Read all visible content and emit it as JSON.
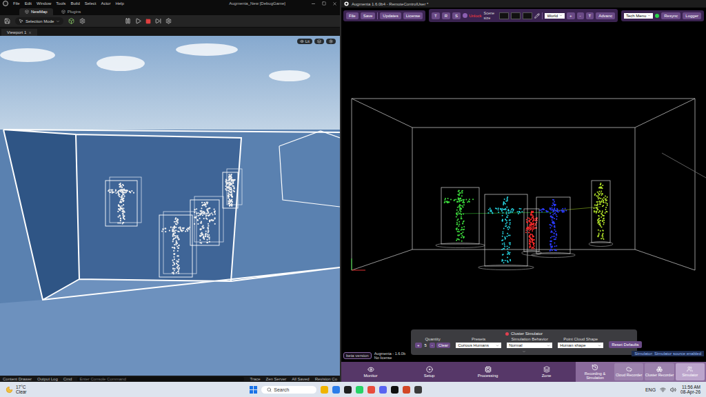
{
  "unreal": {
    "menu": [
      "File",
      "Edit",
      "Window",
      "Tools",
      "Build",
      "Select",
      "Actor",
      "Help"
    ],
    "title": "Augmenta_New [DebugGame]",
    "tabs": [
      {
        "label": "NewMap",
        "selected": true
      },
      {
        "label": "Plugins",
        "selected": false
      }
    ],
    "mode_dropdown": "Selection Mode",
    "viewport_tab": "Viewport 1",
    "view_mode": "Lit",
    "status_bar": {
      "left": [
        "Content Drawer",
        "Output Log"
      ],
      "cmd": "Cmd",
      "console_placeholder": "Enter Console Command",
      "right": [
        "Trace",
        "Zen Server",
        "All Saved",
        "Revision Co"
      ]
    }
  },
  "augmenta": {
    "title": "Augmenta 1.6.0b4 - RemoteControlUser *",
    "toolbar": {
      "file_buttons": [
        "File",
        "Save"
      ],
      "info_buttons": [
        "Updates",
        "License"
      ],
      "transform_buttons": [
        "T",
        "R",
        "S"
      ],
      "lock_button": "Unlock",
      "scene_size_label": "Scene size",
      "space_select": "World",
      "step_buttons": [
        "+",
        "-",
        "T"
      ],
      "advanced": "Advanc",
      "tech_menu": "Tech Menu",
      "resync": "Resync",
      "logger": "Logger"
    },
    "figures": [
      {
        "kind": "t-pose",
        "color": "#3ee03e"
      },
      {
        "kind": "t-pose",
        "color": "#27d3e0"
      },
      {
        "kind": "standing",
        "color": "#ff2b2b"
      },
      {
        "kind": "t-pose",
        "color": "#2b3bff"
      },
      {
        "kind": "standing",
        "color": "#b5e62a"
      }
    ],
    "simulator": {
      "title": "Cluster Simulator",
      "quantity": {
        "label": "Quantity",
        "increment": "+",
        "value": "5",
        "decrement": "-",
        "clear": "Clear"
      },
      "fields": [
        {
          "label": "Presets",
          "value": "Curious Humans"
        },
        {
          "label": "Simulation Behavior",
          "value": "Normal"
        },
        {
          "label": "Point Cloud Shape",
          "value": "Human shape"
        }
      ],
      "reset": "Reset Defaults",
      "toast": "Simulator: Simulator source enabled"
    },
    "badge": "beta version",
    "version": "Augmenta - 1.6.0b",
    "license": "No license",
    "nav": [
      {
        "label": "Monitor",
        "selected": false
      },
      {
        "label": "Setup",
        "selected": false
      },
      {
        "label": "Processing",
        "selected": false
      },
      {
        "label": "Zone",
        "selected": false
      }
    ],
    "mode_group": {
      "label": "Recording & Simulation",
      "selected": true,
      "items": [
        {
          "label": "Cloud Recorder",
          "selected": false
        },
        {
          "label": "Cluster Recorder",
          "selected": false
        },
        {
          "label": "Simulator",
          "selected": true
        }
      ]
    }
  },
  "taskbar": {
    "temperature": "17°C",
    "weather": "Clear",
    "search": "Search",
    "language": "ENG",
    "time": "11:56 AM",
    "date": "08-Apr-26"
  }
}
